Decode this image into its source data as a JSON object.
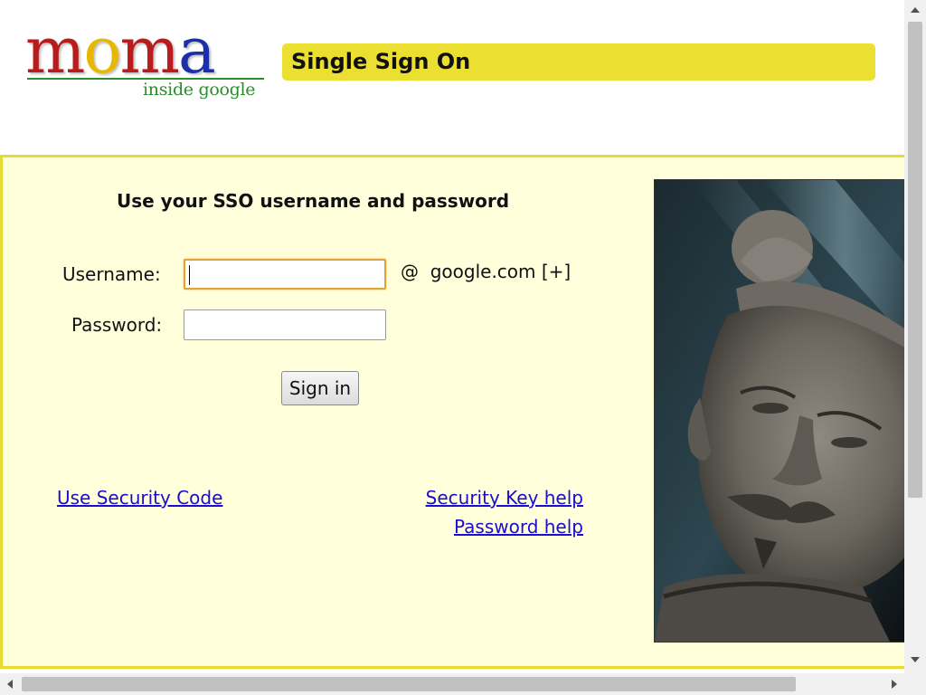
{
  "header": {
    "logo": {
      "letters": [
        "m",
        "o",
        "m",
        "a"
      ],
      "letter_colors": [
        "#b81c1c",
        "#e8b800",
        "#b81c1c",
        "#1c2fa8"
      ],
      "tagline": "inside google",
      "tagline_color": "#2e8b2e"
    },
    "title": "Single Sign On",
    "title_bar_color": "#ebe032"
  },
  "form": {
    "prompt": "Use your SSO username and password",
    "username_label": "Username:",
    "username_value": "",
    "password_label": "Password:",
    "password_value": "",
    "domain_suffix": "@  google.com [+]",
    "signin_label": "Sign in"
  },
  "links": {
    "security_code": "Use Security Code",
    "security_key_help": "Security Key help",
    "password_help": "Password help",
    "link_color": "#1a0dcc"
  },
  "photo": {
    "subject": "terracotta-warrior-statue-photo"
  },
  "colors": {
    "panel_background": "#ffffdc",
    "panel_border": "#e8dc34"
  }
}
